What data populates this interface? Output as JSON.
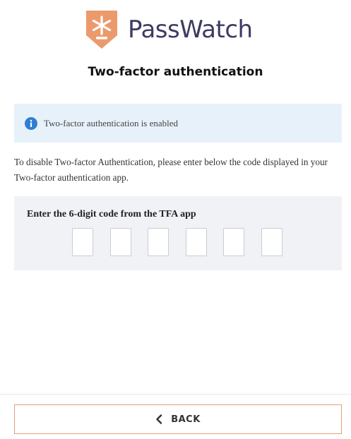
{
  "brand": {
    "name": "PassWatch",
    "logo_icon": "asterisk-shield-icon",
    "accent_color": "#ec9a6c",
    "text_color": "#3d3b63"
  },
  "page": {
    "title": "Two-factor authentication"
  },
  "status": {
    "icon": "info-icon",
    "message": "Two-factor authentication is enabled",
    "background": "#e7f1fa"
  },
  "instructions": "To disable Two-factor Authentication, please enter below the code displayed in your Two-factor authentication app.",
  "code_entry": {
    "label": "Enter the 6-digit code from the TFA app",
    "digits": [
      "",
      "",
      "",
      "",
      "",
      ""
    ]
  },
  "back_button": {
    "icon": "chevron-left-icon",
    "label": "BACK"
  }
}
